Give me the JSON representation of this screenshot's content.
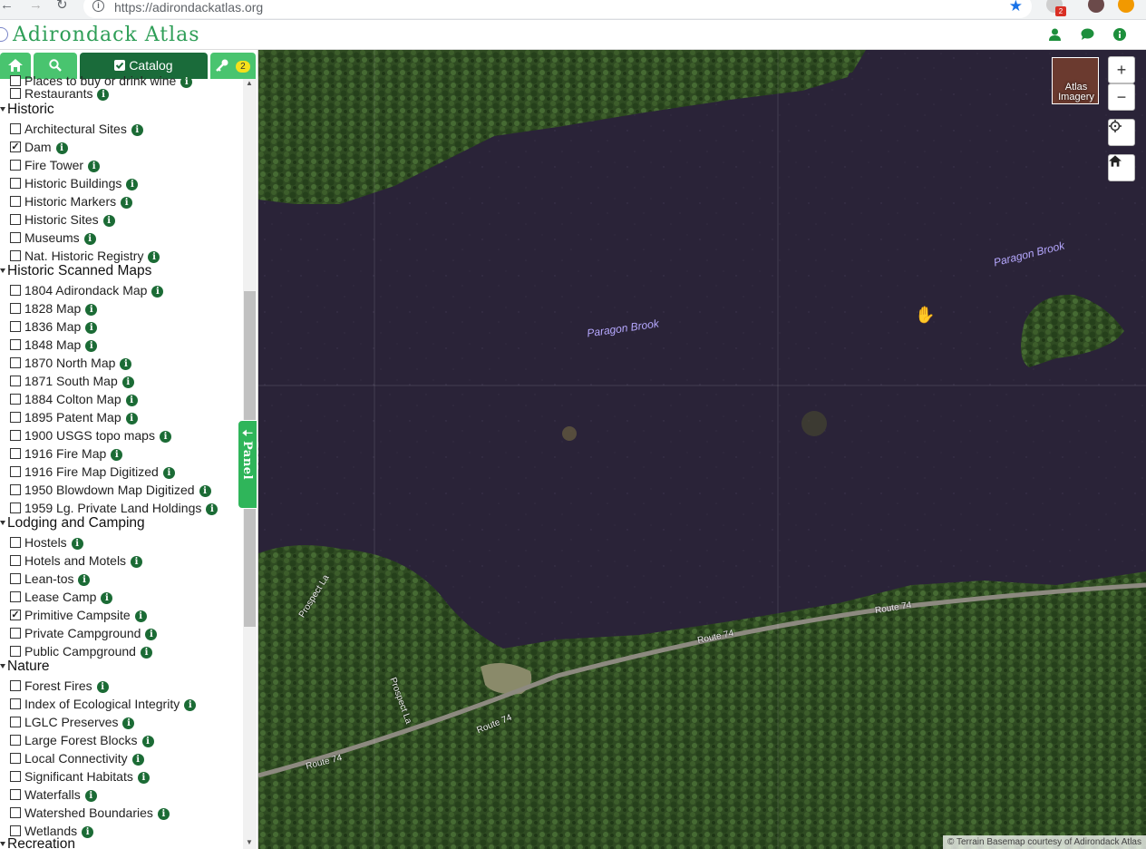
{
  "browser": {
    "url": "https://adirondackatlas.org",
    "badge": "2"
  },
  "app": {
    "title": "Adirondack Atlas"
  },
  "tabs": {
    "catalog_label": "Catalog",
    "keys_count": "2"
  },
  "layers": {
    "partial_top": "Places to buy or drink wine",
    "restaurants": "Restaurants",
    "historic": {
      "title": "Historic",
      "items": [
        "Architectural Sites",
        "Dam",
        "Fire Tower",
        "Historic Buildings",
        "Historic Markers",
        "Historic Sites",
        "Museums",
        "Nat. Historic Registry"
      ]
    },
    "scanned_maps": {
      "title": "Historic Scanned Maps",
      "items": [
        "1804 Adirondack Map",
        "1828 Map",
        "1836 Map",
        "1848 Map",
        "1870 North Map",
        "1871 South Map",
        "1884 Colton Map",
        "1895 Patent Map",
        "1900 USGS topo maps",
        "1916 Fire Map",
        "1916 Fire Map Digitized",
        "1950 Blowdown Map Digitized",
        "1959 Lg. Private Land Holdings"
      ]
    },
    "lodging": {
      "title": "Lodging and Camping",
      "items": [
        "Hostels",
        "Hotels and Motels",
        "Lean-tos",
        "Lease Camp",
        "Primitive Campsite",
        "Private Campground",
        "Public Campground"
      ]
    },
    "nature": {
      "title": "Nature",
      "items": [
        "Forest Fires",
        "Index of Ecological Integrity",
        "LGLC Preserves",
        "Large Forest Blocks",
        "Local Connectivity",
        "Significant Habitats",
        "Waterfalls",
        "Watershed Boundaries",
        "Wetlands"
      ]
    },
    "recreation": {
      "title": "Recreation"
    },
    "checked": [
      "Dam",
      "Primitive Campsite"
    ]
  },
  "side_panel": {
    "label": "Side Panel"
  },
  "map": {
    "labels": {
      "brook_1": "Paragon Brook",
      "brook_2": "Paragon Brook",
      "route": "Route 74",
      "prospect": "Prospect La"
    },
    "basemap": {
      "label": "Atlas Imagery"
    },
    "attribution": "© Terrain Basemap courtesy of Adirondack Atlas"
  },
  "colors": {
    "accent_green": "#49c46f",
    "active_tab": "#1a6b3a",
    "title_green": "#2e9e57",
    "water": "#2a2338",
    "forest": "#2d4a22"
  }
}
